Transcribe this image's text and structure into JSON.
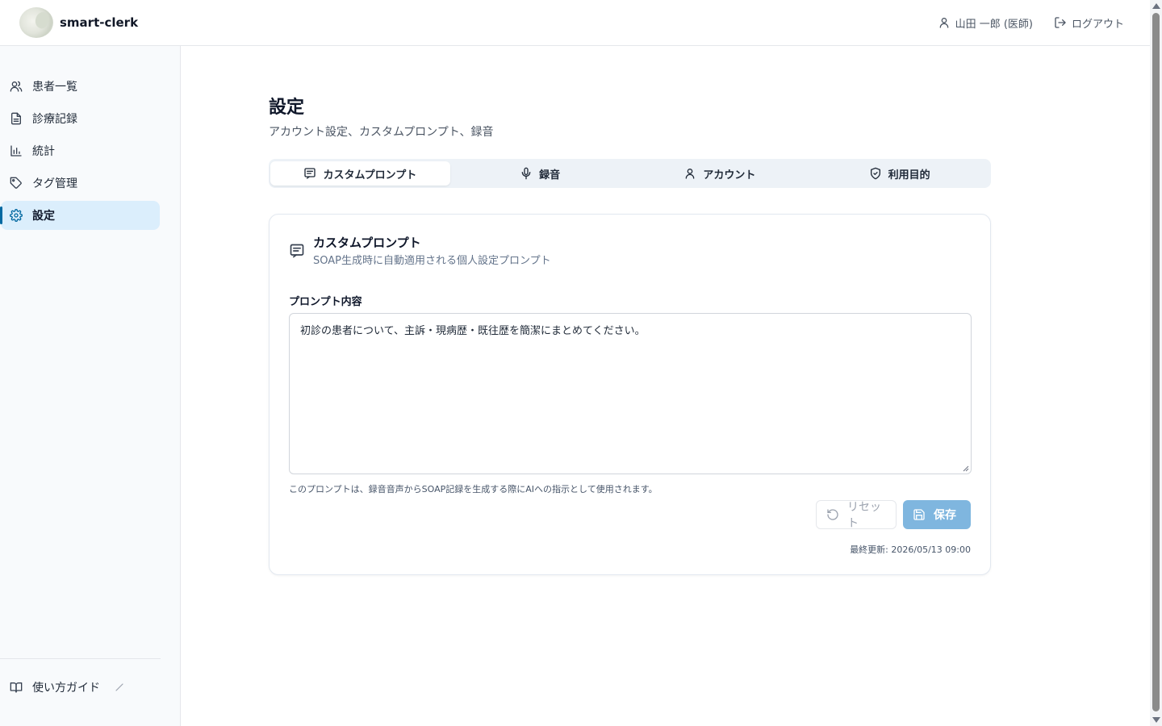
{
  "header": {
    "brand": "smart-clerk",
    "user": "山田 一郎 (医師)",
    "logout": "ログアウト"
  },
  "sidebar": {
    "items": [
      {
        "label": "患者一覧",
        "icon": "users-icon"
      },
      {
        "label": "診療記録",
        "icon": "file-text-icon"
      },
      {
        "label": "統計",
        "icon": "bar-chart-icon"
      },
      {
        "label": "タグ管理",
        "icon": "tag-icon"
      },
      {
        "label": "設定",
        "icon": "gear-icon",
        "active": true
      }
    ],
    "guide": "使い方ガイド"
  },
  "page": {
    "title": "設定",
    "subtitle": "アカウント設定、カスタムプロンプト、録音"
  },
  "tabs": [
    {
      "label": "カスタムプロンプト",
      "icon": "message-square-icon",
      "active": true
    },
    {
      "label": "録音",
      "icon": "mic-icon"
    },
    {
      "label": "アカウント",
      "icon": "user-icon"
    },
    {
      "label": "利用目的",
      "icon": "shield-icon"
    }
  ],
  "card": {
    "title": "カスタムプロンプト",
    "description": "SOAP生成時に自動適用される個人設定プロンプト",
    "field_label": "プロンプト内容",
    "prompt_value": "初診の患者について、主訴・現病歴・既往歴を簡潔にまとめてください。",
    "helper": "このプロンプトは、録音音声からSOAP記録を生成する際にAIへの指示として使用されます。",
    "reset_label": "リセット",
    "save_label": "保存",
    "updated": "最終更新: 2026/05/13 09:00"
  },
  "colors": {
    "accent": "#0369a1",
    "active_nav_bg": "#dbeefc",
    "save_button": "#7fb6df"
  }
}
